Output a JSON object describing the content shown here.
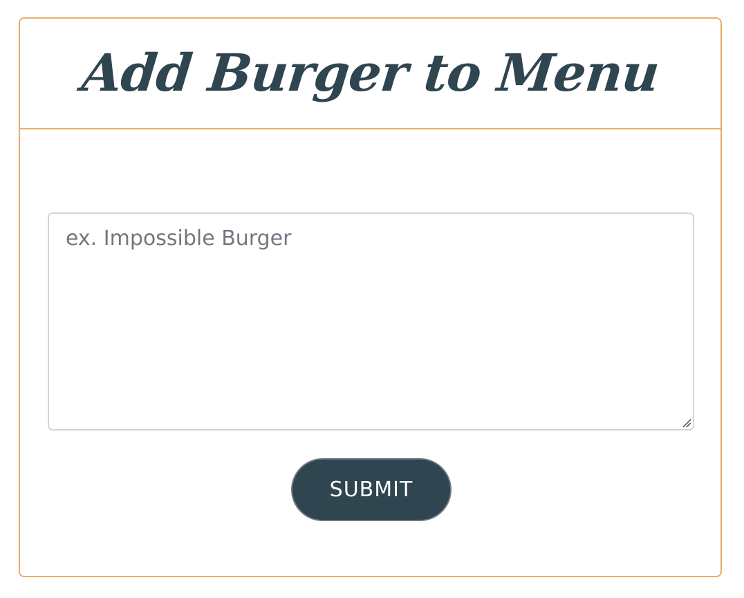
{
  "form": {
    "title": "Add Burger to Menu",
    "input": {
      "value": "",
      "placeholder": "ex. Impossible Burger"
    },
    "submit_label": "SUBMIT"
  },
  "colors": {
    "border_accent": "#e8ae6a",
    "title_text": "#2f4550",
    "button_bg": "#2f4550",
    "button_text": "#ffffff",
    "input_border": "#d3d4d8",
    "placeholder_text": "#73777f"
  },
  "icons": {
    "resize_grip": "resize-grip-icon"
  }
}
